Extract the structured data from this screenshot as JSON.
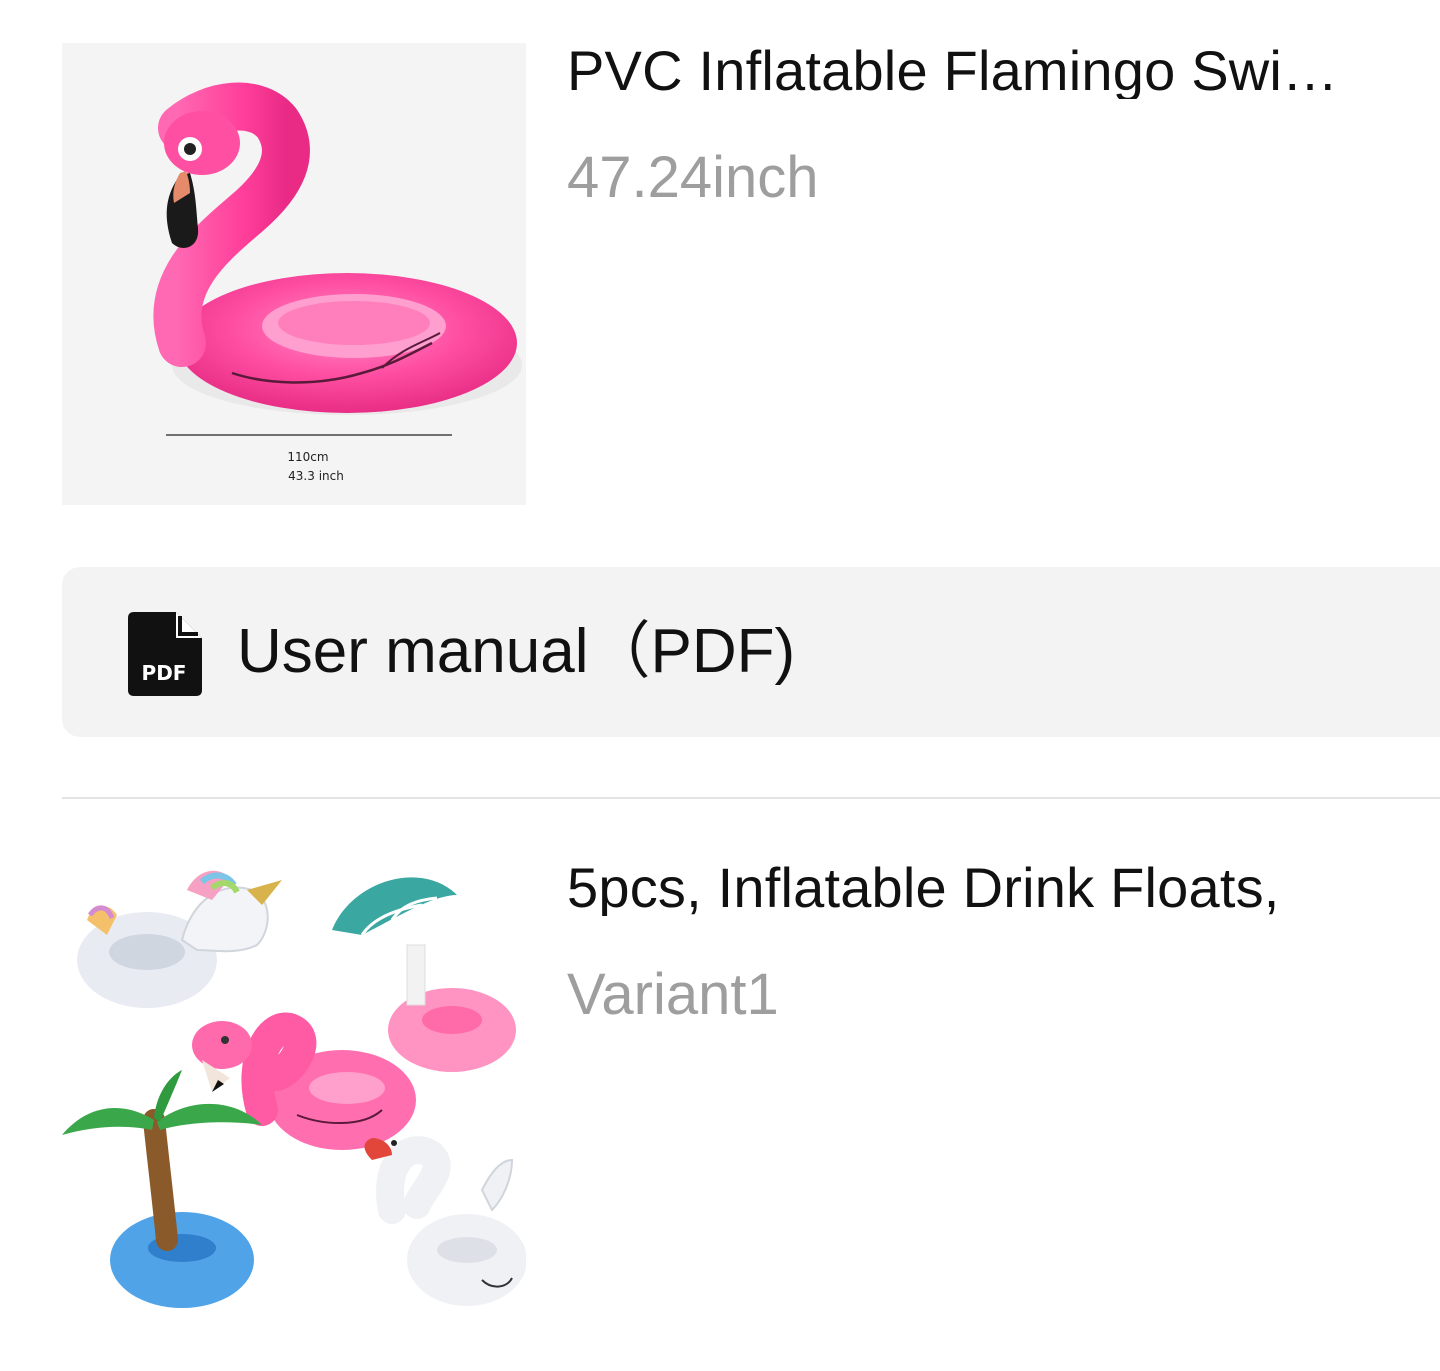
{
  "products": [
    {
      "title": "PVC Inflatable Flamingo Swi…",
      "variant": "47.24inch",
      "image": {
        "icon": "flamingo-swim-ring-image",
        "measure_cm": "110cm",
        "measure_inch": "43.3 inch"
      }
    },
    {
      "title": "5pcs, Inflatable Drink Floats,",
      "variant": "Variant1",
      "image": {
        "icon": "inflatable-drink-floats-image"
      }
    }
  ],
  "manual": {
    "icon_label": "PDF",
    "label": "User manual（PDF)"
  },
  "colors": {
    "flamingo_pink": "#ff4fa3",
    "muted_text": "#9e9e9e",
    "card_bg": "#f3f3f3"
  }
}
